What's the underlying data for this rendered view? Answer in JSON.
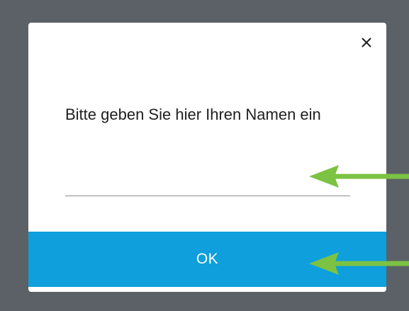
{
  "dialog": {
    "prompt": "Bitte geben Sie hier Ihren Namen ein",
    "name_input": {
      "value": "",
      "placeholder": ""
    },
    "close_icon": "×",
    "ok_label": "OK"
  },
  "annotations": [
    {
      "icon": "green-arrow-icon",
      "points_to": "name-input"
    },
    {
      "icon": "green-arrow-icon",
      "points_to": "ok-button"
    }
  ],
  "colors": {
    "backdrop": "#5b6166",
    "dialog_bg": "#ffffff",
    "accent": "#0e9fdc",
    "annotation_arrow": "#7cc243"
  }
}
